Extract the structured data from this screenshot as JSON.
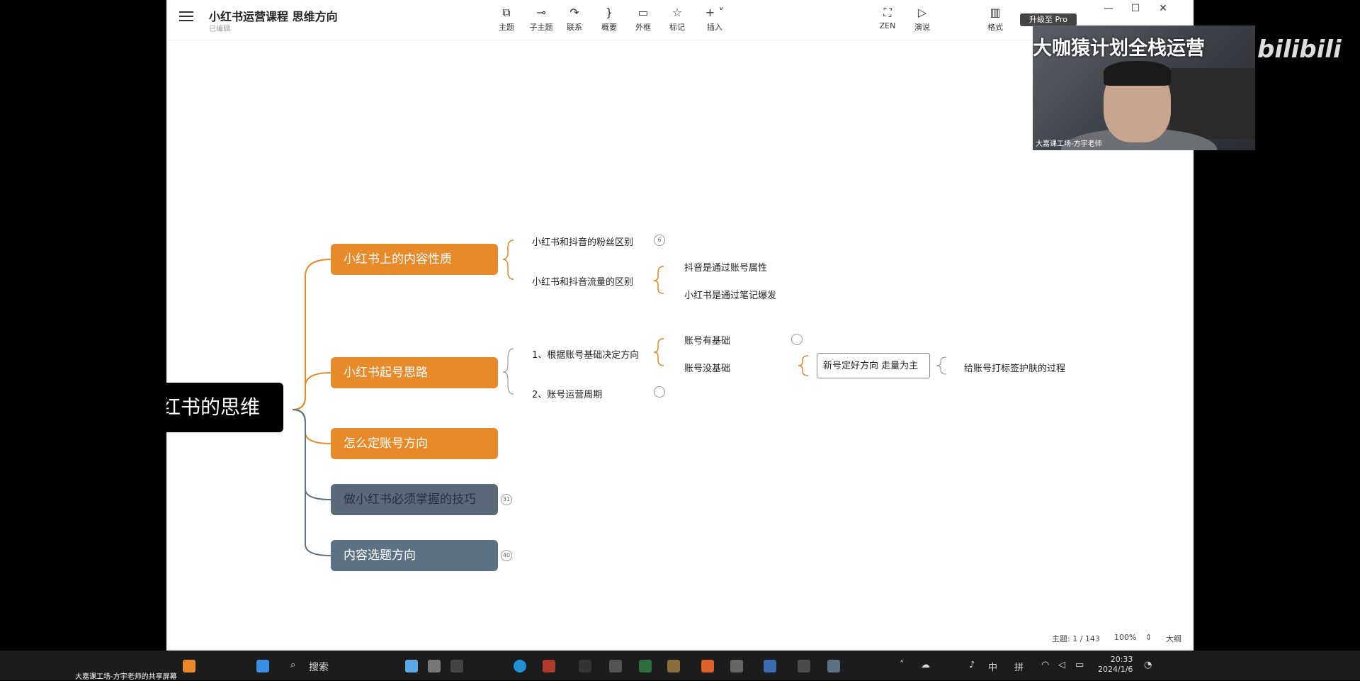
{
  "app": {
    "title": "小红书运营课程 思维方向",
    "status": "已编辑",
    "toolbar": [
      {
        "icon": "topic-icon",
        "glyph": "⧉",
        "label": "主题"
      },
      {
        "icon": "subtopic-icon",
        "glyph": "⊸",
        "label": "子主题"
      },
      {
        "icon": "relation-icon",
        "glyph": "↷",
        "label": "联系"
      },
      {
        "icon": "summary-icon",
        "glyph": "}",
        "label": "概要"
      },
      {
        "icon": "boundary-icon",
        "glyph": "▭",
        "label": "外框"
      },
      {
        "icon": "marker-icon",
        "glyph": "☆",
        "label": "标记"
      },
      {
        "icon": "insert-icon",
        "glyph": "+ ˅",
        "label": "插入"
      },
      {
        "icon": "zen-icon",
        "glyph": "⛶",
        "label": "ZEN"
      },
      {
        "icon": "pitch-icon",
        "glyph": "▷",
        "label": "演说"
      },
      {
        "icon": "format-icon",
        "glyph": "▥",
        "label": "格式"
      }
    ],
    "upgrade_label": "升级至 Pro",
    "window": {
      "minimize": "—",
      "maximize": "☐",
      "close": "✕"
    }
  },
  "mindmap": {
    "root": "红书的思维",
    "branches": [
      {
        "label": "小红书上的内容性质",
        "color": "#e8892a"
      },
      {
        "label": "小红书起号思路",
        "color": "#e8892a"
      },
      {
        "label": "怎么定账号方向",
        "color": "#e8892a"
      },
      {
        "label": "做小红书必须掌握的技巧",
        "color": "#5a6a79",
        "badge": "31"
      },
      {
        "label": "内容选题方向",
        "color": "#5d7184",
        "badge": "40"
      }
    ],
    "leaves": {
      "fans_diff": "小红书和抖音的粉丝区别",
      "fans_badge": "6",
      "traffic_diff": "小红书和抖音流量的区别",
      "douyin": "抖音是通过账号属性",
      "xhs": "小红书是通过笔记爆发",
      "direction_by_base": "1、根据账号基础决定方向",
      "cycle": "2、账号运营周期",
      "has_base": "账号有基础",
      "no_base": "账号没基础",
      "new_account": "新号定好方向 走量为主",
      "tagging": "给账号打标签护肤的过程"
    }
  },
  "statusbar": {
    "topics": "主题: 1 / 143",
    "zoom": "100%",
    "outline": "大纲"
  },
  "overlay": {
    "cam_title": "大咖猿计划全栈运营",
    "cam_caption": "大嘉课工场-方宇老师",
    "platform_logo": "bilibili",
    "bottom_caption": "大嘉课工场-方宇老师的共享屏幕"
  },
  "taskbar": {
    "search": "搜索",
    "ime_lang": "中",
    "ime_mode": "拼",
    "time": "20:33",
    "date": "2024/1/6"
  }
}
